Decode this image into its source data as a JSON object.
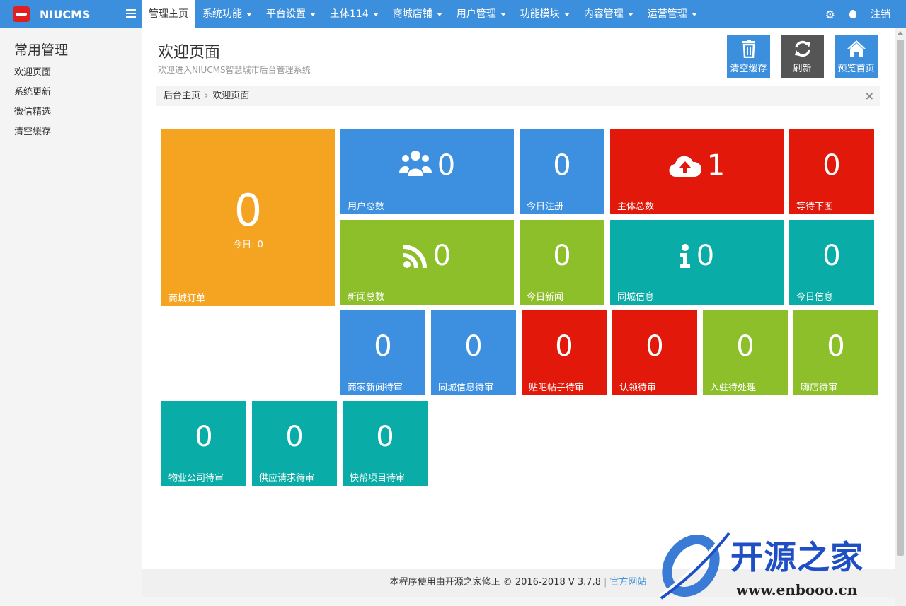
{
  "brand": {
    "name": "NIUCMS"
  },
  "nav": [
    {
      "label": "管理主页",
      "active": true,
      "dropdown": false
    },
    {
      "label": "系统功能",
      "dropdown": true
    },
    {
      "label": "平台设置",
      "dropdown": true
    },
    {
      "label": "主体114",
      "dropdown": true
    },
    {
      "label": "商城店铺",
      "dropdown": true
    },
    {
      "label": "用户管理",
      "dropdown": true
    },
    {
      "label": "功能模块",
      "dropdown": true
    },
    {
      "label": "内容管理",
      "dropdown": true
    },
    {
      "label": "运营管理",
      "dropdown": true
    }
  ],
  "top_right": {
    "logout": "注销"
  },
  "sidebar": {
    "title": "常用管理",
    "items": [
      "欢迎页面",
      "系统更新",
      "微信精选",
      "清空缓存"
    ]
  },
  "page": {
    "title": "欢迎页面",
    "subtitle": "欢迎进入NIUCMS智慧城市后台管理系统"
  },
  "toolbar": {
    "clear_cache": "清空缓存",
    "refresh": "刷新",
    "preview": "预览首页",
    "colors": {
      "clear_cache": "#3c8fdc",
      "refresh": "#555555",
      "preview": "#3c8fdc"
    }
  },
  "breadcrumb": {
    "home": "后台主页",
    "current": "欢迎页面",
    "sep": "›",
    "close": "×"
  },
  "tiles": {
    "orders": {
      "value": "0",
      "today": "今日: 0",
      "label": "商城订单"
    },
    "users": {
      "value": "0",
      "label": "用户总数"
    },
    "today_reg": {
      "value": "0",
      "label": "今日注册"
    },
    "entities": {
      "value": "1",
      "label": "主体总数"
    },
    "pending_img": {
      "value": "0",
      "label": "等待下图"
    },
    "news": {
      "value": "0",
      "label": "新闻总数"
    },
    "today_news": {
      "value": "0",
      "label": "今日新闻"
    },
    "city_info": {
      "value": "0",
      "label": "同城信息"
    },
    "today_info": {
      "value": "0",
      "label": "今日信息"
    },
    "merchant_news": {
      "value": "0",
      "label": "商家新闻待审"
    },
    "city_info_pending": {
      "value": "0",
      "label": "同城信息待审"
    },
    "post_pending": {
      "value": "0",
      "label": "贴吧帖子待审"
    },
    "claim_pending": {
      "value": "0",
      "label": "认领待审"
    },
    "join_pending": {
      "value": "0",
      "label": "入驻待处理"
    },
    "party_pending": {
      "value": "0",
      "label": "嗨店待审"
    },
    "property_pending": {
      "value": "0",
      "label": "物业公司待审"
    },
    "supply_pending": {
      "value": "0",
      "label": "供应请求待审"
    },
    "quickhelp_pending": {
      "value": "0",
      "label": "快帮项目待审"
    }
  },
  "footer": {
    "text": "本程序使用由开源之家修正 © 2016-2018 V 3.7.8",
    "sep": "|",
    "link": "官方网站"
  },
  "watermark": {
    "name": "开源之家",
    "url": "www.enbooo.cn"
  },
  "colors": {
    "topbar": "#3c8fdc",
    "orange": "#f5a422",
    "blue": "#3d8fe0",
    "red": "#e2180a",
    "green": "#8dbf2b",
    "teal": "#09aca6"
  }
}
